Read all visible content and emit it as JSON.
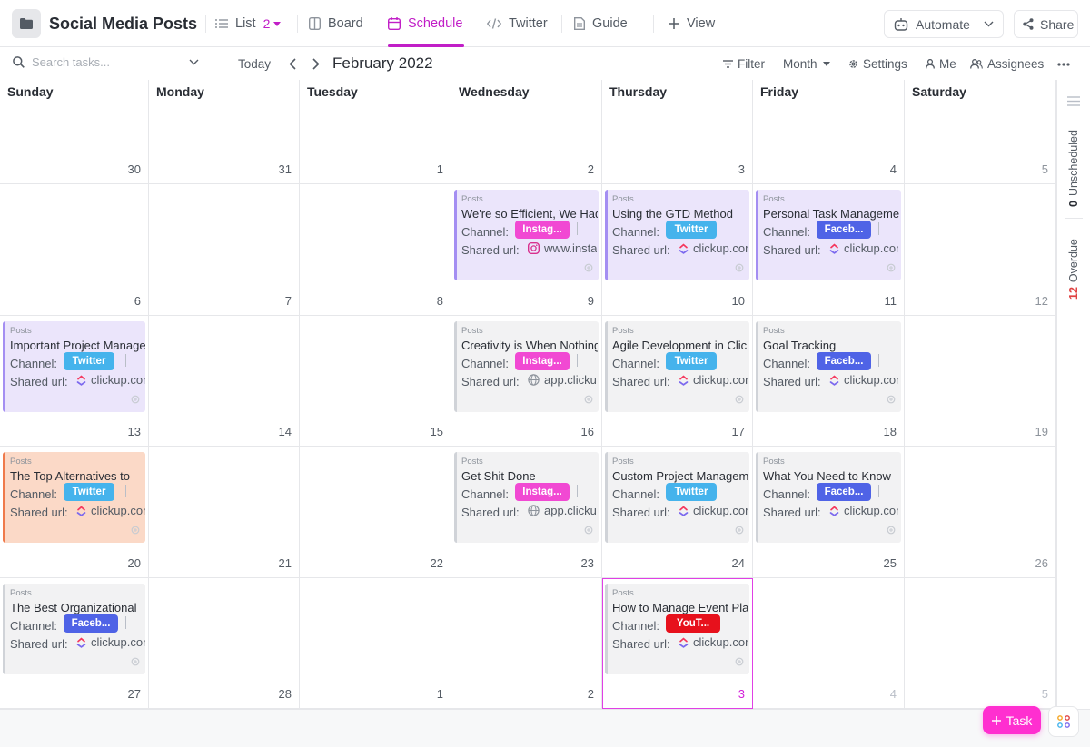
{
  "header": {
    "title": "Social Media Posts",
    "tabs": [
      {
        "label": "List",
        "count": "2"
      },
      {
        "label": "Board"
      },
      {
        "label": "Schedule"
      },
      {
        "label": "Twitter"
      },
      {
        "label": "Guide"
      }
    ],
    "add_view_label": "View",
    "automate_label": "Automate",
    "share_label": "Share"
  },
  "toolbar": {
    "search_placeholder": "Search tasks...",
    "today_label": "Today",
    "month_title": "February 2022",
    "filter_label": "Filter",
    "range_label": "Month",
    "settings_label": "Settings",
    "me_label": "Me",
    "assignees_label": "Assignees"
  },
  "calendar": {
    "day_headers": [
      "Sunday",
      "Monday",
      "Tuesday",
      "Wednesday",
      "Thursday",
      "Friday",
      "Saturday"
    ],
    "weeks": [
      [
        "30",
        "31",
        "1",
        "2",
        "3",
        "4",
        "5"
      ],
      [
        "6",
        "7",
        "8",
        "9",
        "10",
        "11",
        "12"
      ],
      [
        "13",
        "14",
        "15",
        "16",
        "17",
        "18",
        "19"
      ],
      [
        "20",
        "21",
        "22",
        "23",
        "24",
        "25",
        "26"
      ],
      [
        "27",
        "28",
        "1",
        "2",
        "3",
        "4",
        "5"
      ]
    ],
    "cards": [
      {
        "week": 1,
        "day": 3,
        "list": "Posts",
        "title": "We're so Efficient, We Had to Share",
        "channel_label": "Channel:",
        "channel": "Instag...",
        "url_label": "Shared url:",
        "url_icon": "instagram-icon",
        "url": "www.instagram.com",
        "style": "purple"
      },
      {
        "week": 1,
        "day": 4,
        "list": "Posts",
        "title": "Using the GTD Method",
        "channel_label": "Channel:",
        "channel": "Twitter",
        "url_label": "Shared url:",
        "url_icon": "clickup-icon",
        "url": "clickup.com",
        "style": "purple"
      },
      {
        "week": 1,
        "day": 5,
        "list": "Posts",
        "title": "Personal Task Management",
        "channel_label": "Channel:",
        "channel": "Faceb...",
        "url_label": "Shared url:",
        "url_icon": "clickup-icon",
        "url": "clickup.com",
        "style": "purple"
      },
      {
        "week": 2,
        "day": 0,
        "list": "Posts",
        "title": "Important Project Management",
        "channel_label": "Channel:",
        "channel": "Twitter",
        "url_label": "Shared url:",
        "url_icon": "clickup-icon",
        "url": "clickup.com",
        "style": "purple"
      },
      {
        "week": 2,
        "day": 3,
        "list": "Posts",
        "title": "Creativity is When Nothing",
        "channel_label": "Channel:",
        "channel": "Instag...",
        "url_label": "Shared url:",
        "url_icon": "globe-icon",
        "url": "app.clickup.com",
        "style": "gray"
      },
      {
        "week": 2,
        "day": 4,
        "list": "Posts",
        "title": "Agile Development in ClickUp",
        "channel_label": "Channel:",
        "channel": "Twitter",
        "url_label": "Shared url:",
        "url_icon": "clickup-icon",
        "url": "clickup.com",
        "style": "gray"
      },
      {
        "week": 2,
        "day": 5,
        "list": "Posts",
        "title": "Goal Tracking",
        "channel_label": "Channel:",
        "channel": "Faceb...",
        "url_label": "Shared url:",
        "url_icon": "clickup-icon",
        "url": "clickup.com",
        "style": "gray"
      },
      {
        "week": 3,
        "day": 0,
        "list": "Posts",
        "title": "The Top Alternatives to",
        "channel_label": "Channel:",
        "channel": "Twitter",
        "url_label": "Shared url:",
        "url_icon": "clickup-icon",
        "url": "clickup.com",
        "style": "orange"
      },
      {
        "week": 3,
        "day": 3,
        "list": "Posts",
        "title": "Get Shit Done",
        "channel_label": "Channel:",
        "channel": "Instag...",
        "url_label": "Shared url:",
        "url_icon": "globe-icon",
        "url": "app.clickup.com",
        "style": "gray"
      },
      {
        "week": 3,
        "day": 4,
        "list": "Posts",
        "title": "Custom Project Management",
        "channel_label": "Channel:",
        "channel": "Twitter",
        "url_label": "Shared url:",
        "url_icon": "clickup-icon",
        "url": "clickup.com",
        "style": "gray"
      },
      {
        "week": 3,
        "day": 5,
        "list": "Posts",
        "title": "What You Need to Know",
        "channel_label": "Channel:",
        "channel": "Faceb...",
        "url_label": "Shared url:",
        "url_icon": "clickup-icon",
        "url": "clickup.com",
        "style": "gray"
      },
      {
        "week": 4,
        "day": 0,
        "list": "Posts",
        "title": "The Best Organizational",
        "channel_label": "Channel:",
        "channel": "Faceb...",
        "url_label": "Shared url:",
        "url_icon": "clickup-icon",
        "url": "clickup.com",
        "style": "gray"
      },
      {
        "week": 4,
        "day": 4,
        "list": "Posts",
        "title": "How to Manage Event Planning",
        "channel_label": "Channel:",
        "channel": "YouT...",
        "url_label": "Shared url:",
        "url_icon": "clickup-icon",
        "url": "clickup.com",
        "style": "gray"
      }
    ]
  },
  "rail": {
    "unscheduled_count": "0",
    "unscheduled_label": "Unscheduled",
    "overdue_count": "12",
    "overdue_label": "Overdue"
  },
  "fab": {
    "task_label": "Task"
  },
  "colors": {
    "accent": "#c11ec7",
    "instagram": "#f149d3",
    "twitter": "#45b3ec",
    "facebook": "#4f63e6",
    "youtube": "#e7111c",
    "task_button": "#ff2fd0"
  }
}
